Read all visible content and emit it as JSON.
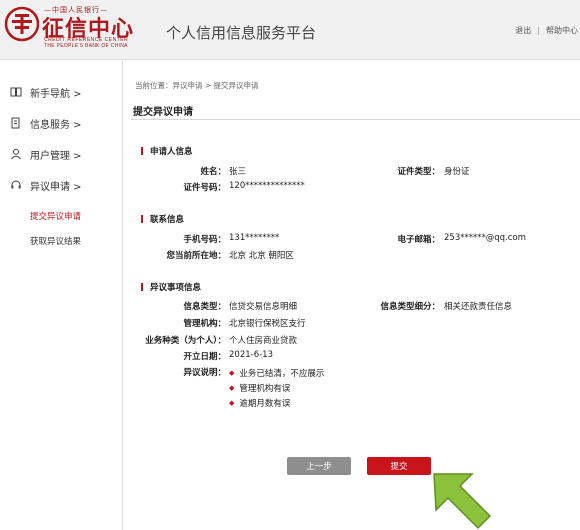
{
  "header": {
    "logo_cn_small": "—中国人民银行—",
    "logo_cn_big": "征信中心",
    "logo_en_line1": "CREDIT REFERENCE CENTER",
    "logo_en_line2": "THE PEOPLE'S BANK OF CHINA",
    "platform_title": "个人信用信息服务平台",
    "logout": "退出",
    "help": "帮助中心"
  },
  "sidebar": {
    "items": [
      {
        "label": "新手导航 >",
        "icon": "book-icon"
      },
      {
        "label": "信息服务 >",
        "icon": "document-icon"
      },
      {
        "label": "用户管理 >",
        "icon": "user-icon"
      },
      {
        "label": "异议申请 >",
        "icon": "headset-icon"
      }
    ],
    "sub_items": [
      {
        "label": "提交异议申请",
        "active": true
      },
      {
        "label": "获取异议结果",
        "active": false
      }
    ]
  },
  "main": {
    "breadcrumb": "当前位置：异议申请 > 提交异议申请",
    "page_title": "提交异议申请",
    "applicant": {
      "heading": "申请人信息",
      "name_label": "姓名：",
      "name_value": "张三",
      "id_type_label": "证件类型：",
      "id_type_value": "身份证",
      "id_no_label": "证件号码：",
      "id_no_value": "120**************"
    },
    "contact": {
      "heading": "联系信息",
      "phone_label": "手机号码：",
      "phone_value": "131********",
      "email_label": "电子邮箱：",
      "email_value": "253******@qq.com",
      "location_label": "您当前所在地：",
      "location_value": "北京 北京 朝阳区"
    },
    "dispute": {
      "heading": "异议事项信息",
      "info_type_label": "信息类型：",
      "info_type_value": "信贷交易信息明细",
      "info_subtype_label": "信息类型细分：",
      "info_subtype_value": "相关还款责任信息",
      "org_label": "管理机构：",
      "org_value": "北京银行保税区支行",
      "biz_type_label": "业务种类（为个人）：",
      "biz_type_value": "个人住房商业贷款",
      "open_date_label": "开立日期：",
      "open_date_value": "2021-6-13",
      "desc_label": "异议说明：",
      "reasons": [
        "业务已结清，不应展示",
        "管理机构有误",
        "逾期月数有误"
      ]
    },
    "buttons": {
      "prev": "上一步",
      "submit": "提交"
    }
  },
  "colors": {
    "brand_red": "#c0141c",
    "arrow_green": "#8cc23b",
    "prev_gray": "#8e8e8e"
  }
}
